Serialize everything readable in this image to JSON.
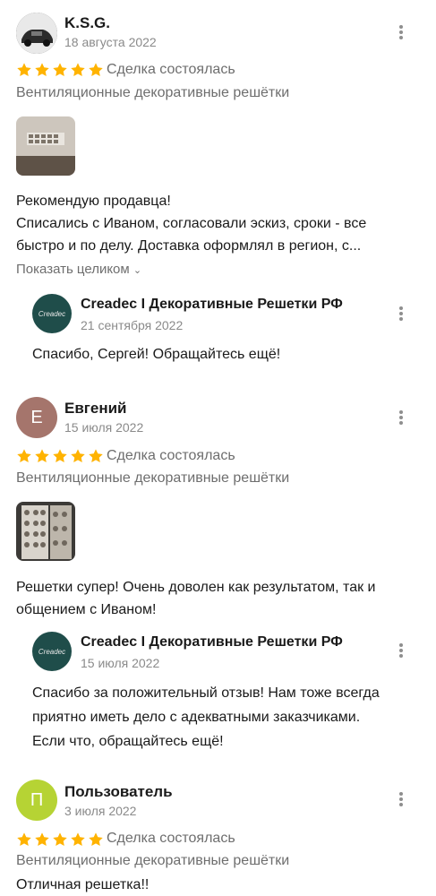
{
  "reviews": [
    {
      "author": "K.S.G.",
      "date": "18 августа 2022",
      "deal_status": "Сделка состоялась",
      "category": "Вентиляционные декоративные решётки",
      "text_line1": "Рекомендую продавца!",
      "text_line2": "Списались с Иваном, согласовали эскиз, сроки - все",
      "text_line3": "быстро и по делу. Доставка оформлял в регион, с...",
      "show_all": "Показать целиком",
      "reply": {
        "author": "Creadec I Декоративные Решетки РФ",
        "date": "21 сентября 2022",
        "text_line1": "Спасибо, Сергей! Обращайтесь ещё!",
        "avatar_text": "Creadec"
      }
    },
    {
      "author": "Евгений",
      "avatar_letter": "Е",
      "date": "15 июля 2022",
      "deal_status": "Сделка состоялась",
      "category": "Вентиляционные декоративные решётки",
      "text_line1": "Решетки супер! Очень доволен как результатом, так и",
      "text_line2": "общением с Иваном!",
      "reply": {
        "author": "Creadec I Декоративные Решетки РФ",
        "date": "15 июля 2022",
        "text_line1": "Спасибо за положительный отзыв! Нам тоже всегда",
        "text_line2": "приятно иметь дело с адекватными заказчиками.",
        "text_line3": "Если что, обращайтесь ещё!",
        "avatar_text": "Creadec"
      }
    },
    {
      "author": "Пользователь",
      "avatar_letter": "П",
      "date": "3 июля 2022",
      "deal_status": "Сделка состоялась",
      "category": "Вентиляционные декоративные решётки",
      "text_line1": "Отличная решетка!!"
    }
  ],
  "rating": {
    "stars": 5,
    "max": 5
  },
  "colors": {
    "star": "#ffb300",
    "avatar_e": "#a5756c",
    "avatar_p": "#b6d334",
    "brand_avatar": "#1f4d4a"
  }
}
